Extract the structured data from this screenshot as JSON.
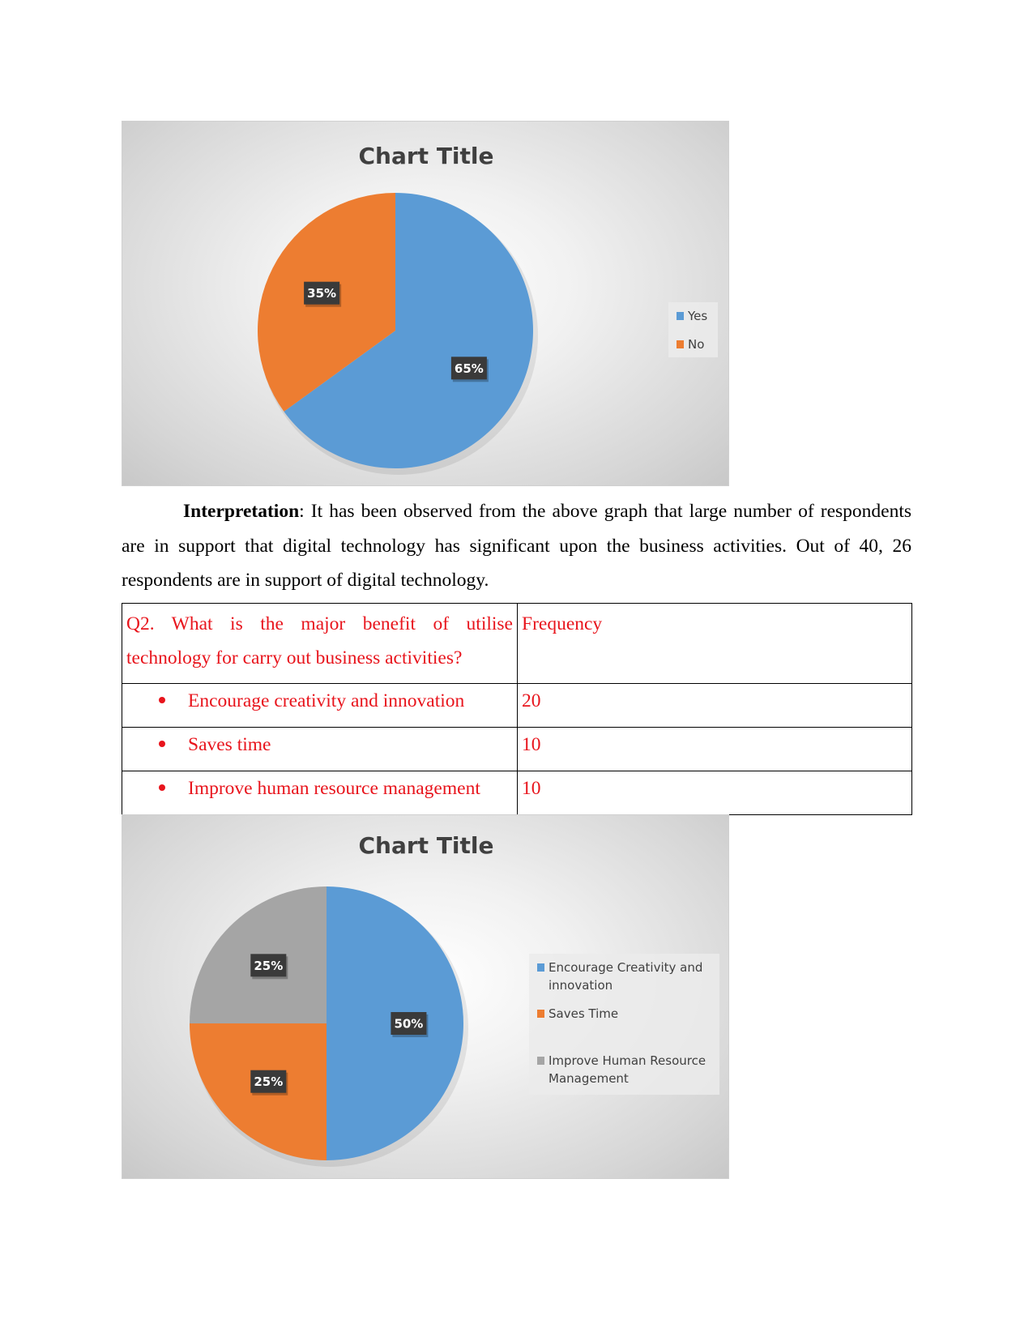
{
  "interpretation": {
    "lead": "Interpretation",
    "text": ": It has been observed from the above graph that large number of respondents are in support that digital technology has significant upon the business activities. Out of 40, 26 respondents are in support of digital technology."
  },
  "table": {
    "header": {
      "question": "Q2. What is the major benefit of utilise technology for carry out business activities?",
      "frequency": "Frequency"
    },
    "rows": [
      {
        "label": "Encourage creativity and innovation",
        "value": "20"
      },
      {
        "label": "Saves time",
        "value": "10"
      },
      {
        "label": "Improve human resource management",
        "value": "10"
      }
    ],
    "text_color": "#e8141c"
  },
  "chart_data": [
    {
      "type": "pie",
      "title": "Chart Title",
      "categories": [
        "Yes",
        "No"
      ],
      "values": [
        65,
        35
      ],
      "labels": [
        "65%",
        "35%"
      ],
      "colors": [
        "#5b9bd5",
        "#ed7d31"
      ],
      "legend": "right",
      "legend_lines": [
        [
          "Yes"
        ],
        [
          "No"
        ]
      ]
    },
    {
      "type": "pie",
      "title": "Chart Title",
      "categories": [
        "Encourage Creativity and innovation",
        "Saves Time",
        "Improve Human Resource Management"
      ],
      "values": [
        50,
        25,
        25
      ],
      "labels": [
        "50%",
        "25%",
        "25%"
      ],
      "colors": [
        "#5b9bd5",
        "#ed7d31",
        "#a5a5a5"
      ],
      "legend": "right",
      "legend_lines": [
        [
          "Encourage Creativity and",
          "innovation"
        ],
        [
          "Saves Time"
        ],
        [
          "Improve Human Resource",
          "Management"
        ]
      ]
    }
  ]
}
